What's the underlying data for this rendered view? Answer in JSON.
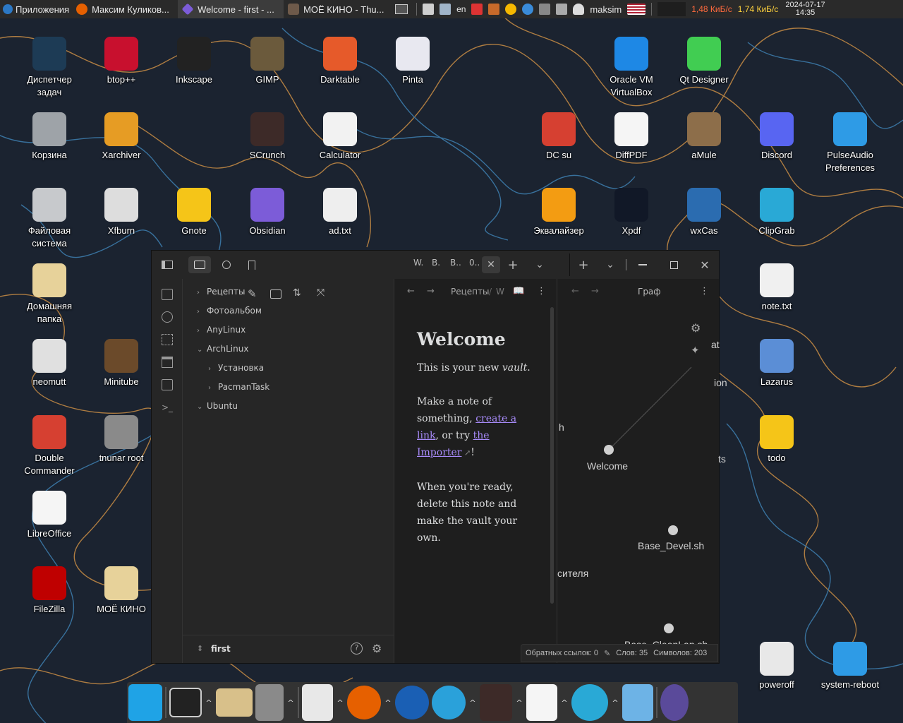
{
  "top_panel": {
    "apps_menu": "Приложения",
    "tasks": [
      {
        "label": "Максим Куликов..."
      },
      {
        "label": "Welcome - first - ..."
      },
      {
        "label": "МОЁ КИНО - Thu..."
      }
    ],
    "keyboard_layout": "en",
    "user": "maksim",
    "net_down": "1,48 КиБ/с",
    "net_up": "1,74 КиБ/с",
    "date": "2024-07-17",
    "time": "14:35"
  },
  "desktop": {
    "icons": [
      {
        "label": "Диспетчер задач",
        "color": "#1d3b55"
      },
      {
        "label": "btop++",
        "color": "#c8102e"
      },
      {
        "label": "Inkscape",
        "color": "#222222"
      },
      {
        "label": "GIMP",
        "color": "#6b5a3c"
      },
      {
        "label": "Darktable",
        "color": "#e65a2a"
      },
      {
        "label": "Pinta",
        "color": "#e8e8f0"
      },
      {
        "label": "Oracle VM VirtualBox",
        "color": "#1e88e5"
      },
      {
        "label": "Qt Designer",
        "color": "#41cd52"
      },
      {
        "label": "Корзина",
        "color": "#9ea3a8"
      },
      {
        "label": "Xarchiver",
        "color": "#e69c24"
      },
      {
        "label": "SCrunch",
        "color": "#3d2a28"
      },
      {
        "label": "Calculator",
        "color": "#f2f2f2"
      },
      {
        "label": "DC su",
        "color": "#d64031"
      },
      {
        "label": "DiffPDF",
        "color": "#f5f5f5"
      },
      {
        "label": "aMule",
        "color": "#8d6e4a"
      },
      {
        "label": "Discord",
        "color": "#5865f2"
      },
      {
        "label": "PulseAudio Preferences",
        "color": "#2e9be6"
      },
      {
        "label": "Файловая система",
        "color": "#c7c9cc"
      },
      {
        "label": "Xfburn",
        "color": "#dddddd"
      },
      {
        "label": "Gnote",
        "color": "#f5c518"
      },
      {
        "label": "Obsidian",
        "color": "#7c5cd8"
      },
      {
        "label": "ad.txt",
        "color": "#eeeeee"
      },
      {
        "label": "Эквалайзер",
        "color": "#f39c12"
      },
      {
        "label": "Xpdf",
        "color": "#111827"
      },
      {
        "label": "wxCas",
        "color": "#2b6cb0"
      },
      {
        "label": "ClipGrab",
        "color": "#29a9d6"
      },
      {
        "label": "Домашняя папка",
        "color": "#e7d29a"
      },
      {
        "label": "note.txt",
        "color": "#f0f0f0"
      },
      {
        "label": "neomutt",
        "color": "#e0e0e0"
      },
      {
        "label": "Minitube",
        "color": "#6b4a2a"
      },
      {
        "label": "Lazarus",
        "color": "#5b8ed6"
      },
      {
        "label": "Double Commander",
        "color": "#d64031"
      },
      {
        "label": "tnunar root",
        "color": "#8a8a8a"
      },
      {
        "label": "todo",
        "color": "#f5c518"
      },
      {
        "label": "LibreOffice",
        "color": "#f5f5f5"
      },
      {
        "label": "FileZilla",
        "color": "#bf0000"
      },
      {
        "label": "МОЁ КИНО",
        "color": "#e7d29a"
      },
      {
        "label": "poweroff",
        "color": "#e8e8e8"
      },
      {
        "label": "system-reboot",
        "color": "#2e9be6"
      }
    ]
  },
  "obsidian": {
    "tabs_short": [
      "W.",
      "B.",
      "B..",
      "0.."
    ],
    "breadcrumb": [
      "Рецепты",
      "W"
    ],
    "graph_title": "Граф",
    "tree": [
      {
        "label": "Рецепты",
        "level": 0
      },
      {
        "label": "Фотоальбом",
        "level": 0
      },
      {
        "label": "AnyLinux",
        "level": 0
      },
      {
        "label": "ArchLinux",
        "level": 0
      },
      {
        "label": "Установка",
        "level": 1
      },
      {
        "label": "PacmanTask",
        "level": 1
      },
      {
        "label": "Ubuntu",
        "level": 0
      }
    ],
    "vault_name": "first",
    "note": {
      "title": "Welcome",
      "p1_a": "This is your new ",
      "p1_em": "vault",
      "p1_b": ".",
      "p2_a": "Make a note of something, ",
      "p2_link1": "create a link",
      "p2_b": ", or try ",
      "p2_link2": "the Importer",
      "p2_c": "!",
      "p3": "When you're ready, delete this note and make the vault your own."
    },
    "graph": {
      "labels": [
        "Welcome",
        "Base_Devel.sh",
        "Base_CleanLan.sh",
        "сителя",
        "h",
        "at",
        "ion",
        "ts"
      ]
    },
    "status": {
      "backlinks": "Обратных ссылок: 0",
      "words": "Слов: 35",
      "chars": "Символов: 203"
    }
  }
}
